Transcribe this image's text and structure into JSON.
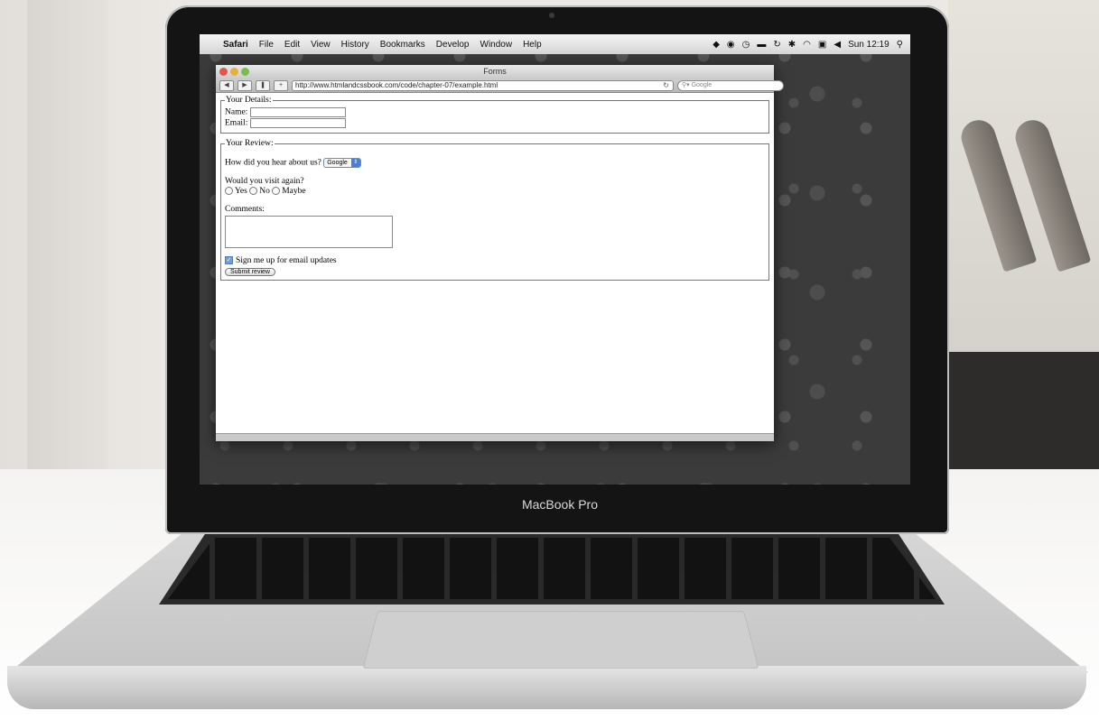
{
  "menubar": {
    "apple": "",
    "items": [
      "Safari",
      "File",
      "Edit",
      "View",
      "History",
      "Bookmarks",
      "Develop",
      "Window",
      "Help"
    ],
    "clock": "Sun 12:19"
  },
  "window": {
    "title": "Forms",
    "url": "http://www.htmlandcssbook.com/code/chapter-07/example.html",
    "search_placeholder": "Google"
  },
  "form": {
    "details_legend": "Your Details:",
    "name_label": "Name:",
    "email_label": "Email:",
    "review_legend": "Your Review:",
    "hear_label": "How did you hear about us?",
    "hear_selected": "Google",
    "visit_label": "Would you visit again?",
    "visit_options": [
      "Yes",
      "No",
      "Maybe"
    ],
    "comments_label": "Comments:",
    "signup_label": "Sign me up for email updates",
    "submit_label": "Submit review"
  },
  "device": {
    "brand": "MacBook Pro"
  }
}
